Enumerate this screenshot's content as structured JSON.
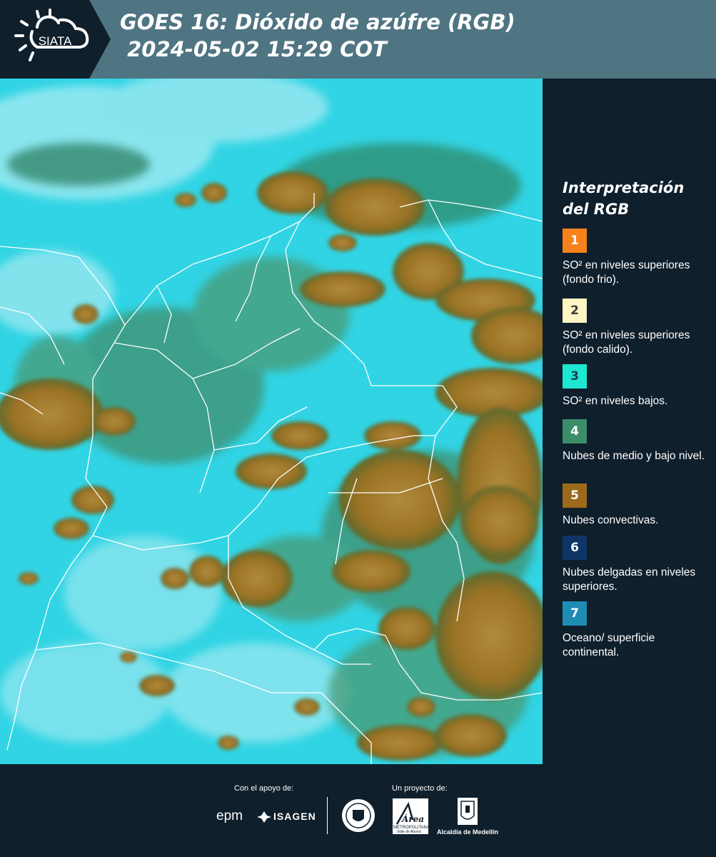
{
  "header": {
    "brand": "SIATA",
    "title_line1": "GOES 16: Dióxido de azúfre (RGB)",
    "title_line2": " 2024-05-02 15:29 COT"
  },
  "map": {
    "ocean_land_color": "#31d4e4",
    "convective_cloud_color": "#a0762a",
    "mid_low_cloud_color": "#3f8f6e",
    "border_color": "#ffffff"
  },
  "legend": {
    "title_line1": "Interpretación",
    "title_line2": "del RGB",
    "items": [
      {
        "number": "1",
        "color": "#f7821b",
        "text_color": "#ffffff",
        "description": "SO² en niveles superiores (fondo frio)."
      },
      {
        "number": "2",
        "color": "#fcf5c4",
        "text_color": "#3b3b3b",
        "description": "SO² en niveles superiores (fondo calido)."
      },
      {
        "number": "3",
        "color": "#1ee7d2",
        "text_color": "#1d3d4a",
        "description": "SO² en niveles bajos."
      },
      {
        "number": "4",
        "color": "#3c8d6a",
        "text_color": "#ffffff",
        "description": "Nubes de medio y bajo nivel."
      },
      {
        "number": "5",
        "color": "#9d6a1b",
        "text_color": "#ffffff",
        "description": "Nubes convectivas."
      },
      {
        "number": "6",
        "color": "#0e3566",
        "text_color": "#ffffff",
        "description": "Nubes delgadas en niveles superiores."
      },
      {
        "number": "7",
        "color": "#1f8cb4",
        "text_color": "#ffffff",
        "description": "Oceano/ superficie continental."
      }
    ]
  },
  "footer": {
    "support_label": "Con el apoyo de:",
    "project_label": "Un proyecto de:",
    "sponsor_epm": "epm",
    "sponsor_isagen": "ISAGEN",
    "partner_area": "Área",
    "partner_area_sub": "METROPOLITANA",
    "partner_area_sub2": "Valle de Aburrá",
    "partner_medellin": "Alcaldía de Medellín"
  }
}
